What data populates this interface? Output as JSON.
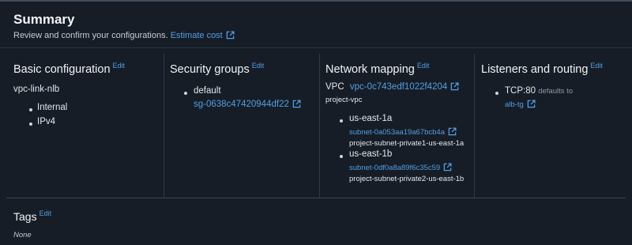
{
  "summary": {
    "title": "Summary",
    "description": "Review and confirm your configurations.",
    "estimate_cost_link": "Estimate cost"
  },
  "edit_label": "Edit",
  "basic": {
    "title": "Basic configuration",
    "name": "vpc-link-nlb",
    "items": [
      "Internal",
      "IPv4"
    ]
  },
  "security": {
    "title": "Security groups",
    "item_label": "default",
    "item_id": "sg-0638c47420944df22"
  },
  "network": {
    "title": "Network mapping",
    "vpc_label": "VPC",
    "vpc_id": "vpc-0c743edf1022f4204",
    "vpc_name": "project-vpc",
    "zones": [
      {
        "az": "us-east-1a",
        "subnet_id": "subnet-0a053aa19a67bcb4a",
        "subnet_name": "project-subnet-private1-us-east-1a"
      },
      {
        "az": "us-east-1b",
        "subnet_id": "subnet-0df0a8a89f6c35c59",
        "subnet_name": "project-subnet-private2-us-east-1b"
      }
    ]
  },
  "listeners": {
    "title": "Listeners and routing",
    "listener": "TCP:80",
    "defaults_to": "defaults to",
    "target": "alb-tg"
  },
  "tags": {
    "title": "Tags",
    "value": "None"
  },
  "colors": {
    "background": "#0f1b2a",
    "panel": "#161d26",
    "link": "#539fe5",
    "text": "#e5e7eb"
  }
}
